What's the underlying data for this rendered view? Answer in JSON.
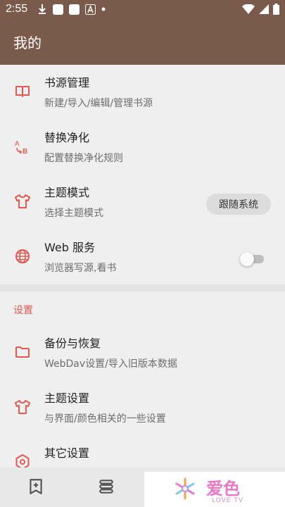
{
  "status_bar": {
    "time": "2:55"
  },
  "app_bar": {
    "title": "我的"
  },
  "items": [
    {
      "title": "书源管理",
      "subtitle": "新建/导入/编辑/管理书源",
      "icon": "book-icon"
    },
    {
      "title": "替换净化",
      "subtitle": "配置替换净化规则",
      "icon": "replace-icon"
    },
    {
      "title": "主题模式",
      "subtitle": "选择主题模式",
      "icon": "tshirt-icon",
      "value": "跟随系统"
    },
    {
      "title": "Web 服务",
      "subtitle": "浏览器写源,看书",
      "icon": "globe-icon",
      "enabled": false
    }
  ],
  "settings": {
    "header": "设置",
    "items": [
      {
        "title": "备份与恢复",
        "subtitle": "WebDav设置/导入旧版本数据",
        "icon": "folder-icon"
      },
      {
        "title": "主题设置",
        "subtitle": "与界面/颜色相关的一些设置",
        "icon": "tshirt-icon"
      },
      {
        "title": "其它设置",
        "subtitle": "",
        "icon": "settings-icon"
      }
    ]
  },
  "watermark": {
    "text": "爱色",
    "sub": "LOVE TV"
  },
  "colors": {
    "primary": "#7a5a4a",
    "accent": "#e05a52",
    "background": "#efefef"
  }
}
